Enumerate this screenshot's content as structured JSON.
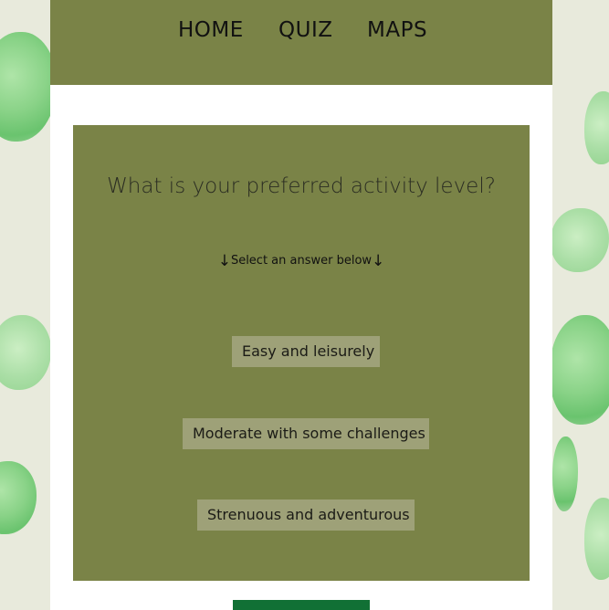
{
  "nav": {
    "items": [
      {
        "label": "HOME"
      },
      {
        "label": "QUIZ"
      },
      {
        "label": "MAPS"
      }
    ]
  },
  "quiz": {
    "question": "What is your preferred activity level?",
    "hint_arrow_left": "↓",
    "hint_text": "Select an answer below",
    "hint_arrow_right": "↓",
    "answers": [
      {
        "label": "Easy and leisurely"
      },
      {
        "label": "Moderate with some challenges"
      },
      {
        "label": "Strenuous and adventurous"
      }
    ]
  },
  "colors": {
    "nav_bg": "#7a8347",
    "card_bg": "#7a8347",
    "answer_bg": "#9ea178",
    "bottom_button_bg": "#117035",
    "page_bg": "#e8eadc"
  }
}
